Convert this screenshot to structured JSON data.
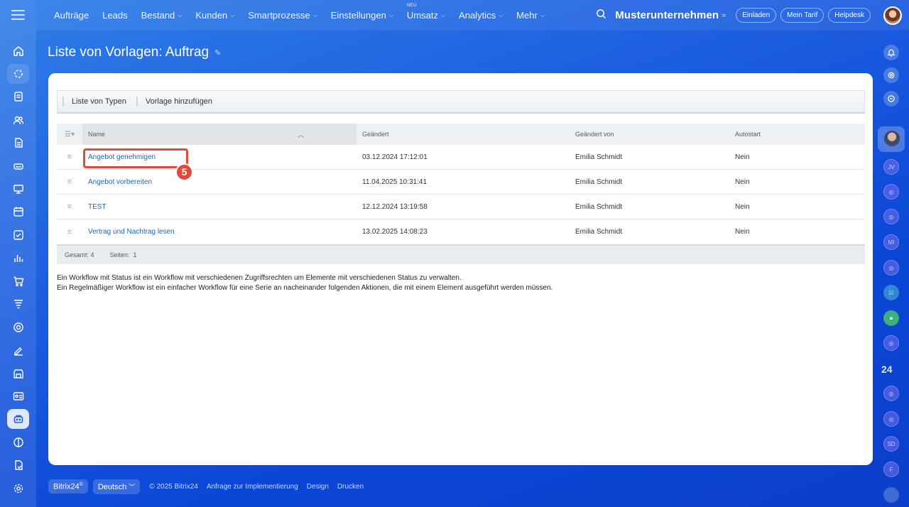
{
  "nav": {
    "items": [
      {
        "label": "Aufträge",
        "chevron": false
      },
      {
        "label": "Leads",
        "chevron": false
      },
      {
        "label": "Bestand",
        "chevron": true
      },
      {
        "label": "Kunden",
        "chevron": true
      },
      {
        "label": "Smartprozesse",
        "chevron": true
      },
      {
        "label": "Einstellungen",
        "chevron": true
      },
      {
        "label": "Umsatz",
        "chevron": true,
        "badge": "NEU"
      },
      {
        "label": "Analytics",
        "chevron": true
      },
      {
        "label": "Mehr",
        "chevron": true
      }
    ]
  },
  "header": {
    "company": "Musterunternehmen",
    "invite_label": "Einladen",
    "tariff_label": "Mein Tarif",
    "helpdesk_label": "Helpdesk"
  },
  "page": {
    "title": "Liste von Vorlagen: Auftrag"
  },
  "toolbar": {
    "types_label": "Liste von Typen",
    "add_label": "Vorlage hinzufügen"
  },
  "grid": {
    "columns": {
      "name": "Name",
      "changed": "Geändert",
      "changed_by": "Geändert von",
      "autostart": "Autostart"
    },
    "rows": [
      {
        "name": "Angebot genehmigen",
        "changed": "03.12.2024 17:12:01",
        "changed_by": "Emilia Schmidt",
        "autostart": "Nein"
      },
      {
        "name": "Angebot vorbereiten",
        "changed": "11.04.2025 10:31:41",
        "changed_by": "Emilia Schmidt",
        "autostart": "Nein"
      },
      {
        "name": "TEST",
        "changed": "12.12.2024 13:19:58",
        "changed_by": "Emilia Schmidt",
        "autostart": "Nein"
      },
      {
        "name": "Vertrag und Nachtrag lesen",
        "changed": "13.02.2025 14:08:23",
        "changed_by": "Emilia Schmidt",
        "autostart": "Nein"
      }
    ],
    "footer": {
      "total": "Gesamt: 4",
      "pages": "Seiten:  1"
    }
  },
  "annotation": {
    "step": "5"
  },
  "notes": {
    "line1": "Ein Workflow mit Status ist ein Workflow mit verschiedenen Zugriffsrechten um Elemente mit verschiedenen Status zu verwalten.",
    "line2": "Ein Regelmäßiger Workflow ist ein einfacher Workflow für eine Serie an nacheinander folgenden Aktionen, die mit einem Element ausgeführt werden müssen."
  },
  "footer": {
    "brand": "Bitrix24",
    "brand_mark": "©",
    "language": "Deutsch",
    "copyright": "© 2025 Bitrix24",
    "link_impl": "Anfrage zur Implementierung",
    "link_design": "Design",
    "link_print": "Drucken"
  },
  "rightbar": {
    "avatars": [
      "JV",
      "MI",
      "SD",
      "F"
    ],
    "logo_24": "24"
  },
  "colors": {
    "link": "#2067b0",
    "accent_red": "#e2483b",
    "background": "#1d5fe0"
  }
}
